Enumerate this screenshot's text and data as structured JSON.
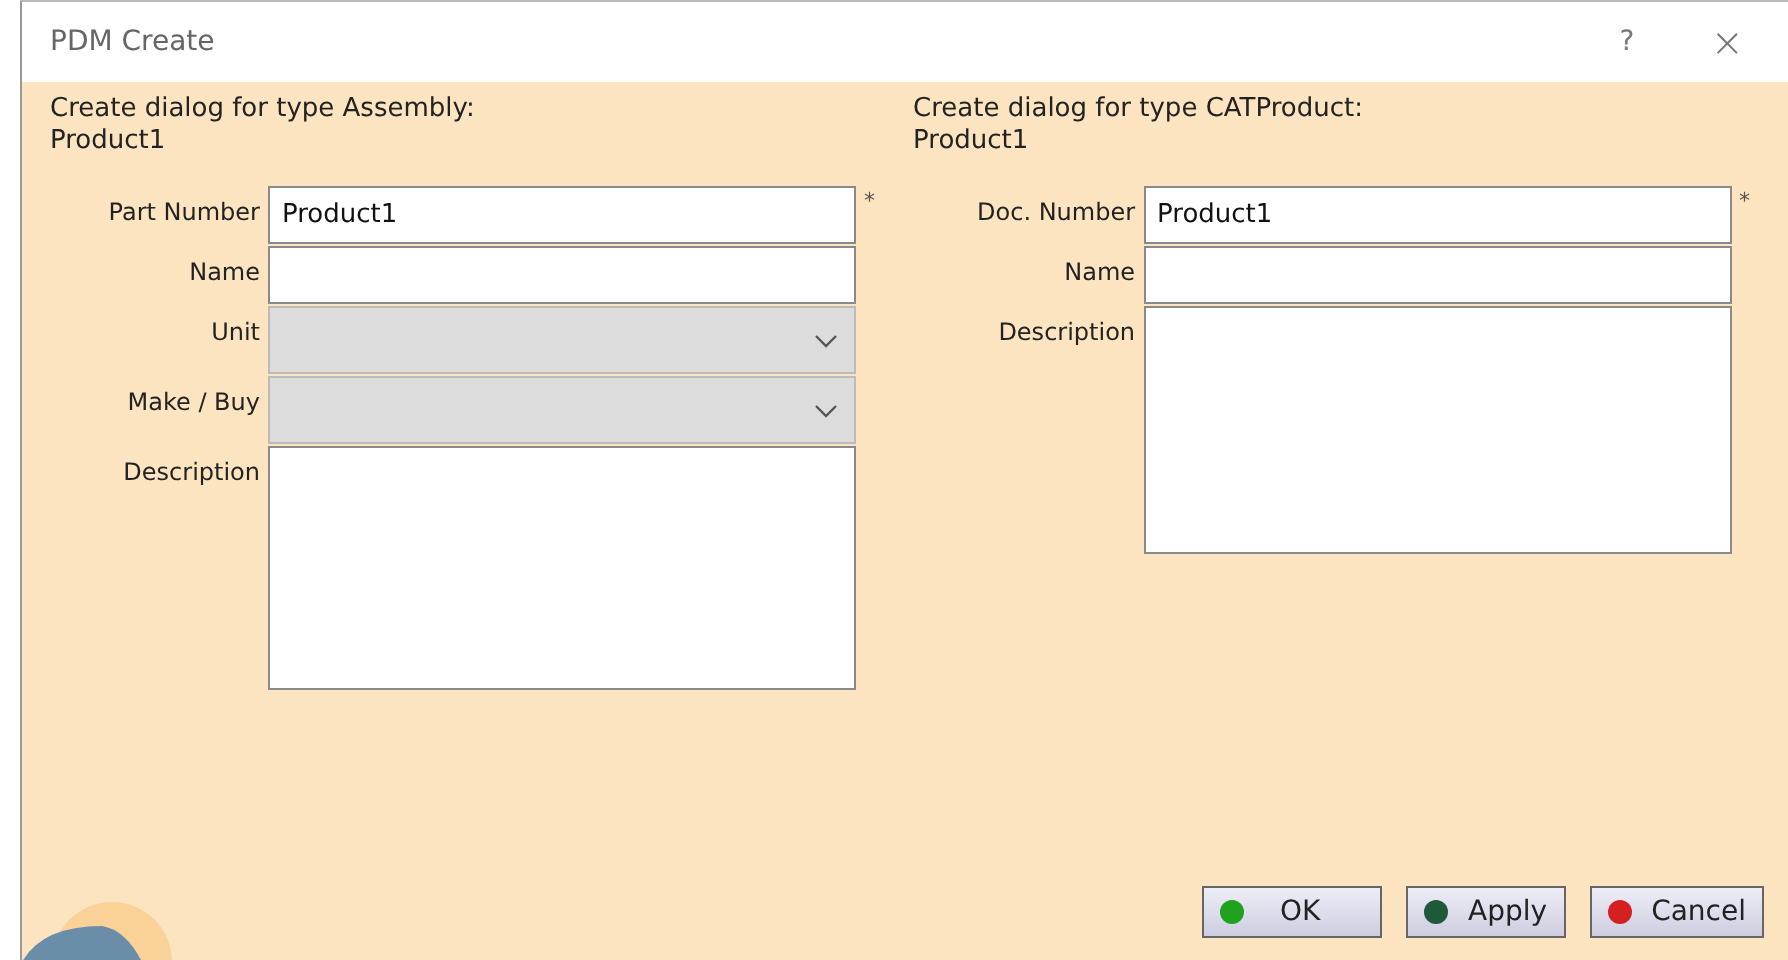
{
  "window": {
    "title": "PDM Create",
    "help": "?",
    "close": "×"
  },
  "panels": [
    {
      "heading": "Create dialog for type Assembly:",
      "subheading": "Product1",
      "fields": [
        {
          "kind": "text",
          "label": "Part Number",
          "value": "Product1",
          "marker": "*",
          "disabled": false
        },
        {
          "kind": "text",
          "label": "Name",
          "disabled": false
        },
        {
          "kind": "select",
          "label": "Unit",
          "disabled": true
        },
        {
          "kind": "select",
          "label": "Make / Buy",
          "disabled": true
        },
        {
          "kind": "textarea",
          "label": "Description",
          "disabled": false
        }
      ]
    },
    {
      "heading": "Create dialog for type CATProduct:",
      "subheading": "Product1",
      "fields": [
        {
          "kind": "text",
          "label": "Doc. Number",
          "value": "Product1",
          "marker": "*",
          "disabled": false
        },
        {
          "kind": "text",
          "label": "Name",
          "disabled": false
        },
        {
          "kind": "textarea",
          "label": "Description",
          "disabled": false
        }
      ]
    }
  ],
  "buttons": [
    {
      "label": "OK",
      "color": "#1fa31f"
    },
    {
      "label": "Apply",
      "color": "#1e5a3a"
    },
    {
      "label": "Cancel",
      "color": "#d42020"
    }
  ]
}
